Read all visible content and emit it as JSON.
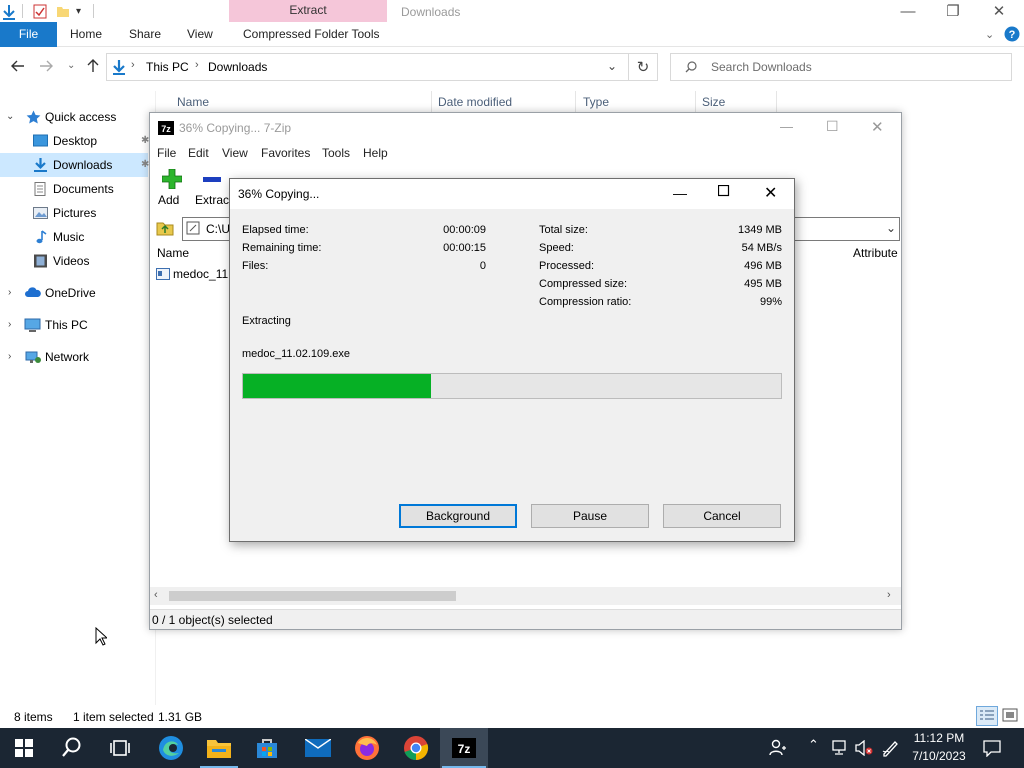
{
  "explorer": {
    "window_title": "Downloads",
    "context_tab": "Extract",
    "ribbon_tabs": {
      "file": "File",
      "home": "Home",
      "share": "Share",
      "view": "View",
      "compressed": "Compressed Folder Tools"
    },
    "breadcrumb": {
      "root": "This PC",
      "current": "Downloads"
    },
    "search_placeholder": "Search Downloads",
    "columns": {
      "name": "Name",
      "date": "Date modified",
      "type": "Type",
      "size": "Size"
    },
    "nav": {
      "quick_access": "Quick access",
      "desktop": "Desktop",
      "downloads": "Downloads",
      "documents": "Documents",
      "pictures": "Pictures",
      "music": "Music",
      "videos": "Videos",
      "onedrive": "OneDrive",
      "this_pc": "This PC",
      "network": "Network"
    },
    "status": {
      "items": "8 items",
      "selected": "1 item selected",
      "size": "1.31 GB"
    }
  },
  "zip": {
    "title": "36% Copying... 7-Zip",
    "menu": {
      "file": "File",
      "edit": "Edit",
      "view": "View",
      "favorites": "Favorites",
      "tools": "Tools",
      "help": "Help"
    },
    "toolbar": {
      "add": "Add",
      "extract": "Extract"
    },
    "path_value": "C:\\U",
    "col_name": "Name",
    "col_attributes": "Attribute",
    "file_item": "medoc_11.",
    "status": "0 / 1 object(s) selected"
  },
  "progress_dialog": {
    "title": "36% Copying...",
    "left": {
      "elapsed_label": "Elapsed time:",
      "elapsed_value": "00:00:09",
      "remaining_label": "Remaining time:",
      "remaining_value": "00:00:15",
      "files_label": "Files:",
      "files_value": "0"
    },
    "right": {
      "total_label": "Total size:",
      "total_value": "1349 MB",
      "speed_label": "Speed:",
      "speed_value": "54 MB/s",
      "processed_label": "Processed:",
      "processed_value": "496 MB",
      "compressed_label": "Compressed size:",
      "compressed_value": "495 MB",
      "ratio_label": "Compression ratio:",
      "ratio_value": "99%"
    },
    "operation": "Extracting",
    "filename": "medoc_11.02.109.exe",
    "progress_fraction": 0.35,
    "buttons": {
      "background": "Background",
      "pause": "Pause",
      "cancel": "Cancel"
    }
  },
  "taskbar": {
    "time": "11:12 PM",
    "date": "7/10/2023",
    "apps": [
      "start-icon",
      "search-icon",
      "task-view-icon",
      "edge-icon",
      "file-explorer-icon",
      "store-icon",
      "mail-icon",
      "firefox-icon",
      "chrome-icon",
      "7zip-icon"
    ]
  },
  "colors": {
    "accent": "#1979ca",
    "progress": "#06b025",
    "context_tab": "#f5c6d9",
    "taskbar": "#1b2633"
  }
}
